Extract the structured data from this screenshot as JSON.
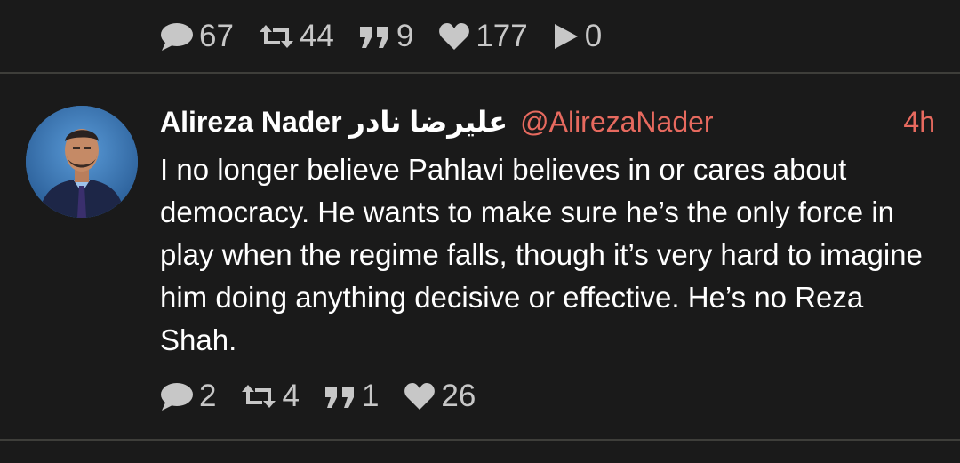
{
  "prev_tweet": {
    "actions": {
      "replies": "67",
      "retweets": "44",
      "quotes": "9",
      "likes": "177",
      "views": "0"
    }
  },
  "tweet": {
    "display_name": "Alireza Nader",
    "display_name_fa": "علیرضا نادر",
    "handle": "@AlirezaNader",
    "time": "4h",
    "text": "I no longer believe Pahlavi believes in or cares about democracy. He wants to make sure he’s the only force in play when the regime falls, though it’s very hard to imagine him doing anything decisive or effective. He’s no Reza Shah.",
    "actions": {
      "replies": "2",
      "retweets": "4",
      "quotes": "1",
      "likes": "26"
    }
  },
  "colors": {
    "background": "#1a1a1a",
    "accent": "#e76a5f",
    "icon": "#c7c7c7",
    "divider": "#3e3e3a"
  },
  "icons": [
    "speech-bubble-icon",
    "retweet-icon",
    "quote-icon",
    "heart-icon",
    "play-icon"
  ]
}
